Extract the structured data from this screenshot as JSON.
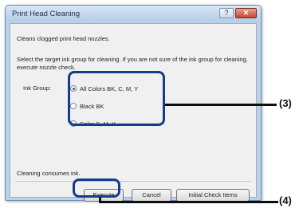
{
  "dialog": {
    "title": "Print Head Cleaning",
    "help_glyph": "?",
    "close_glyph": "✕",
    "description": "Cleans clogged print head nozzles.",
    "instruction": "Select the target ink group for cleaning. If you are not sure of the ink group for cleaning, execute nozzle check.",
    "ink_group_label": "Ink Group:",
    "ink_options": [
      {
        "label": "All Colors  BK, C, M, Y",
        "selected": true
      },
      {
        "label": "Black   BK",
        "selected": false
      },
      {
        "label": "Color   C, M, Y",
        "selected": false
      }
    ],
    "consumes_note": "Cleaning consumes ink.",
    "buttons": {
      "execute": "Execute",
      "cancel": "Cancel",
      "initial_check": "Initial Check Items"
    }
  },
  "callouts": {
    "radio_group": "(3)",
    "execute_button": "(4)"
  },
  "colors": {
    "highlight": "#173b8c",
    "title_bar": "#b5cde8",
    "close_button": "#c8452f"
  }
}
